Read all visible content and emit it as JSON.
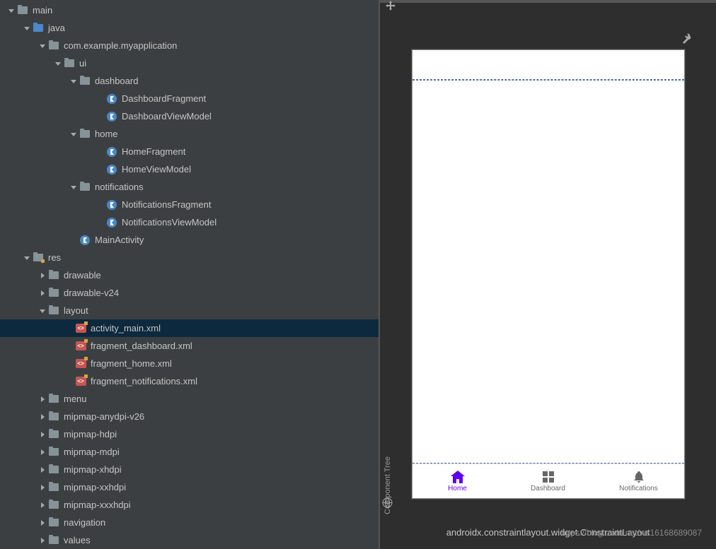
{
  "tree": {
    "main": "main",
    "java": "java",
    "package": "com.example.myapplication",
    "ui": "ui",
    "dashboard": "dashboard",
    "dashboardFragment": "DashboardFragment",
    "dashboardViewModel": "DashboardViewModel",
    "home": "home",
    "homeFragment": "HomeFragment",
    "homeViewModel": "HomeViewModel",
    "notifications": "notifications",
    "notificationsFragment": "NotificationsFragment",
    "notificationsViewModel": "NotificationsViewModel",
    "mainActivity": "MainActivity",
    "res": "res",
    "drawable": "drawable",
    "drawableV24": "drawable-v24",
    "layout": "layout",
    "activityMain": "activity_main.xml",
    "fragmentDashboard": "fragment_dashboard.xml",
    "fragmentHome": "fragment_home.xml",
    "fragmentNotifications": "fragment_notifications.xml",
    "menu": "menu",
    "mipmapAnydpi": "mipmap-anydpi-v26",
    "mipmapHdpi": "mipmap-hdpi",
    "mipmapMdpi": "mipmap-mdpi",
    "mipmapXhdpi": "mipmap-xhdpi",
    "mipmapXxhdpi": "mipmap-xxhdpi",
    "mipmapXxxhdpi": "mipmap-xxxhdpi",
    "navigation": "navigation",
    "values": "values"
  },
  "preview": {
    "componentTree": "Component Tree",
    "bottomText": "androidx.constraintlayout.widget.ConstraintLayout",
    "watermark": "https://blog.csdn.net/ws16168689087",
    "nav": {
      "home": "Home",
      "dashboard": "Dashboard",
      "notifications": "Notifications"
    }
  }
}
